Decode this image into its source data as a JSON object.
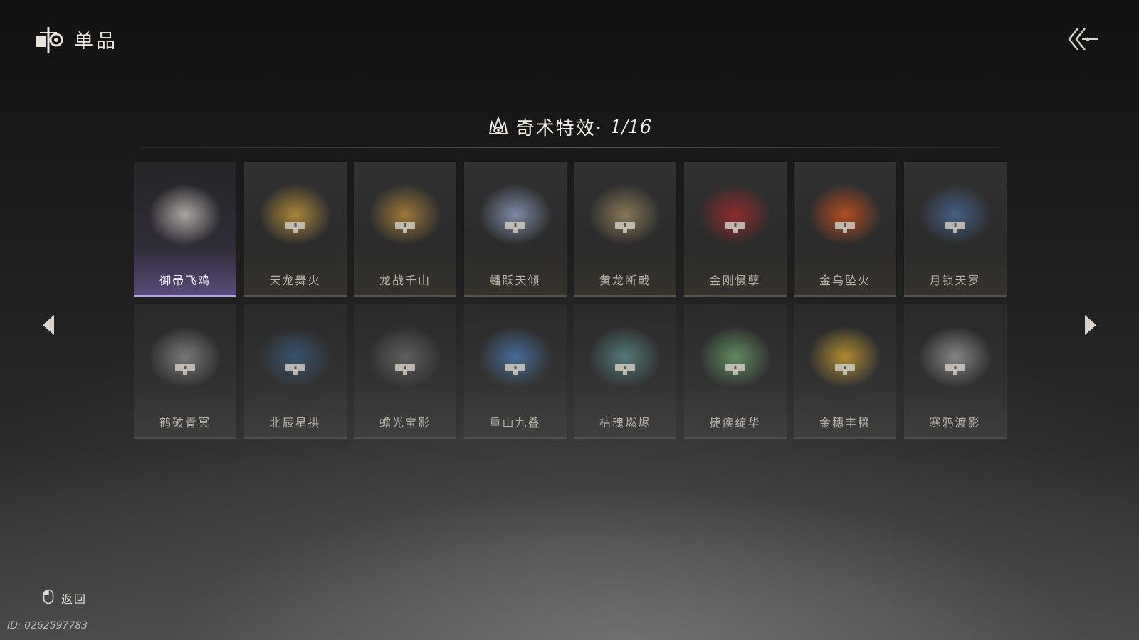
{
  "header": {
    "title": "单品",
    "icon": "item-emblem-icon"
  },
  "back_button": {
    "icon": "double-chevron-back-icon"
  },
  "section": {
    "label": "奇术特效·",
    "count": "1/16",
    "icon": "flame-eye-icon"
  },
  "nav": {
    "left_icon": "triangle-left-icon",
    "right_icon": "triangle-right-icon"
  },
  "items": [
    {
      "name": "御帚飞鸡",
      "locked": false,
      "selected": true,
      "color": "#c9c4bb"
    },
    {
      "name": "天龙舞火",
      "locked": true,
      "selected": false,
      "color": "#c89a3a"
    },
    {
      "name": "龙战千山",
      "locked": true,
      "selected": false,
      "color": "#b8893a"
    },
    {
      "name": "蟠跃天倾",
      "locked": true,
      "selected": false,
      "color": "#8fa0c4"
    },
    {
      "name": "黄龙断戟",
      "locked": true,
      "selected": false,
      "color": "#9c8a5e"
    },
    {
      "name": "金刚慑孽",
      "locked": true,
      "selected": false,
      "color": "#a52a2a"
    },
    {
      "name": "金乌坠火",
      "locked": true,
      "selected": false,
      "color": "#d2551e"
    },
    {
      "name": "月锁天罗",
      "locked": true,
      "selected": false,
      "color": "#4a6a9a"
    },
    {
      "name": "鹤破青冥",
      "locked": true,
      "selected": false,
      "color": "#8a8a8a"
    },
    {
      "name": "北辰星拱",
      "locked": true,
      "selected": false,
      "color": "#3a5a7a"
    },
    {
      "name": "蟾光宝影",
      "locked": true,
      "selected": false,
      "color": "#6a6a6a"
    },
    {
      "name": "重山九叠",
      "locked": true,
      "selected": false,
      "color": "#4a7ab0"
    },
    {
      "name": "枯魂燃烬",
      "locked": true,
      "selected": false,
      "color": "#5a8a8a"
    },
    {
      "name": "捷疾绽华",
      "locked": true,
      "selected": false,
      "color": "#6aa06a"
    },
    {
      "name": "金穗丰穰",
      "locked": true,
      "selected": false,
      "color": "#d0a030"
    },
    {
      "name": "寒鸦渡影",
      "locked": true,
      "selected": false,
      "color": "#9a9a9a"
    }
  ],
  "footer": {
    "label": "返回",
    "icon": "mouse-icon"
  },
  "player_id": "ID: 0262597783"
}
